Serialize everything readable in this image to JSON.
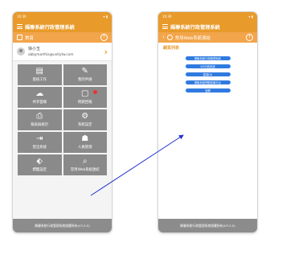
{
  "left_phone": {
    "status_time": "10:30",
    "status_icons": "▾ ▮",
    "app_title": "媽聯系統行政管理系統",
    "logo_line1": "",
    "logo_line2": "",
    "subbar_label": "首頁",
    "user_name": "徐小玉",
    "user_email": "abbymarthia@unitytw.com",
    "tiles": [
      {
        "icon": "doc-icon",
        "glyph": "▤",
        "label": "簽核工作"
      },
      {
        "icon": "pencil-icon",
        "glyph": "✎",
        "label": "我的申請"
      },
      {
        "icon": "cloud-icon",
        "glyph": "☁",
        "label": "共享雲端"
      },
      {
        "icon": "chat-icon",
        "glyph": "▢",
        "label": "問題回報"
      },
      {
        "icon": "report-icon",
        "glyph": "⎙",
        "label": "報表與統計"
      },
      {
        "icon": "gear-icon",
        "glyph": "⚙",
        "label": "系統設定"
      },
      {
        "icon": "logout-icon",
        "glyph": "⇥",
        "label": "登出系統"
      },
      {
        "icon": "person-icon",
        "glyph": "☗",
        "label": "人員管理"
      },
      {
        "icon": "tag-icon",
        "glyph": "⬖",
        "label": "標籤設定"
      },
      {
        "icon": "link-icon",
        "glyph": "⌕",
        "label": "常用Web系統連結"
      }
    ],
    "footer": "媽聯系統行政管理系統版權所有(V3.3.5)"
  },
  "right_phone": {
    "status_time": "10:30",
    "status_icons": "▾ ▮",
    "app_title": "媽聯系統行政管理系統",
    "subbar_label": "常用Web系統連結",
    "section_title": "網頁列表",
    "links": [
      "媽聯系統行政管理系統",
      "VIS行政系統",
      "雲端OA",
      "媽聯系統問題回報平台",
      "官網"
    ],
    "footer": "媽聯系統行政管理系統版權所有(V3.3.5)"
  },
  "colors": {
    "brand_orange": "#e89a2a",
    "tile_gray": "#8a8a8a",
    "link_blue": "#2f7be0",
    "arrow_blue": "#2233cc"
  }
}
